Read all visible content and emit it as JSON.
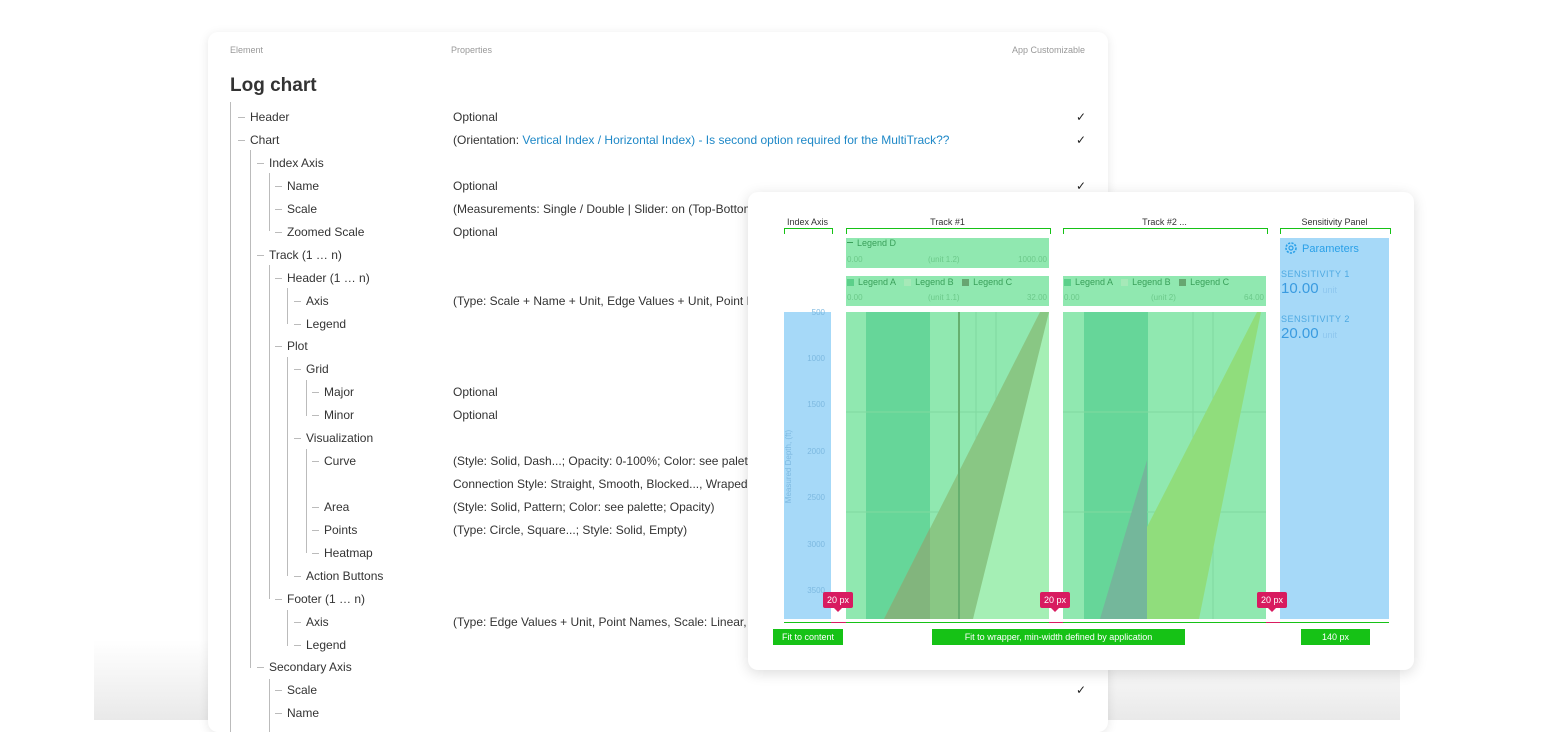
{
  "spec": {
    "col_element": "Element",
    "col_properties": "Properties",
    "col_custom": "App Customizable",
    "title": "Log chart",
    "rows": [
      {
        "label": "Header",
        "prop": "Optional",
        "check": "✓"
      },
      {
        "label": "Chart",
        "prop": "(Orientation: ",
        "prop_link": "Vertical Index / Horizontal Index) - Is second option required for the MultiTrack??",
        "check": "✓"
      },
      {
        "label": "Index Axis",
        "prop": "",
        "check": ""
      },
      {
        "label": "Name",
        "prop": "Optional",
        "check": "✓"
      },
      {
        "label": "Scale",
        "prop": "(Measurements: Single / Double | Slider: on (Top-Bottom",
        "check": ""
      },
      {
        "label": "Zoomed Scale",
        "prop": "Optional",
        "check": ""
      },
      {
        "label": "Track (1 … n)",
        "prop": "",
        "check": ""
      },
      {
        "label": "Header (1 … n)",
        "prop": "",
        "check": ""
      },
      {
        "label": "Axis",
        "prop": "(Type: Scale + Name + Unit, Edge Values + Unit, Point Na",
        "check": ""
      },
      {
        "label": "Legend",
        "prop": "",
        "check": ""
      },
      {
        "label": "Plot",
        "prop": "",
        "check": ""
      },
      {
        "label": "Grid",
        "prop": "",
        "check": ""
      },
      {
        "label": "Major",
        "prop": "Optional",
        "check": ""
      },
      {
        "label": "Minor",
        "prop": "Optional",
        "check": ""
      },
      {
        "label": "Visualization",
        "prop": "",
        "check": ""
      },
      {
        "label": "Curve",
        "prop": "(Style: Solid, Dash...; Opacity: 0-100%; Color: see palette,",
        "check": ""
      },
      {
        "label": "",
        "prop": "Connection Style: Straight, Smooth, Blocked..., Wraped: C",
        "check": ""
      },
      {
        "label": "Area",
        "prop": "(Style: Solid, Pattern; Color: see palette; Opacity)",
        "check": ""
      },
      {
        "label": "Points",
        "prop": "(Type: Circle, Square...; Style: Solid, Empty)",
        "check": ""
      },
      {
        "label": "Heatmap",
        "prop": "",
        "check": ""
      },
      {
        "label": "Action Buttons",
        "prop": "",
        "check": ""
      },
      {
        "label": "Footer (1 … n)",
        "prop": "",
        "check": ""
      },
      {
        "label": "Axis",
        "prop": "(Type: Edge Values + Unit, Point Names, Scale: Linear, Lo",
        "check": ""
      },
      {
        "label": "Legend",
        "prop": "",
        "check": ""
      },
      {
        "label": "Secondary Axis",
        "prop": "",
        "check": ""
      },
      {
        "label": "Scale",
        "prop": "",
        "check": "✓"
      },
      {
        "label": "Name",
        "prop": "",
        "check": ""
      }
    ]
  },
  "chart": {
    "index_axis_title": "Index Axis",
    "track1_title": "Track #1",
    "track2_title": "Track #2 ...",
    "sensitivity_title": "Sensitivity Panel",
    "legend_d": "Legend D",
    "legend_a": "Legend A",
    "legend_b": "Legend B",
    "legend_c": "Legend C",
    "track1_top": {
      "min": "0.00",
      "unit": "(unit 1.2)",
      "max": "1000.00"
    },
    "track1_axis": {
      "min": "0.00",
      "unit": "(unit 1.1)",
      "max": "32.00"
    },
    "track2_axis": {
      "min": "0.00",
      "unit": "(unit 2)",
      "max": "64.00"
    },
    "depth_label": "Measured Depth, (ft)",
    "depth_ticks": [
      "500",
      "1000",
      "1500",
      "2000",
      "2500",
      "3000",
      "3500"
    ],
    "parameters_label": "Parameters",
    "sens1_label": "SENSITIVITY 1",
    "sens1_value": "10.00",
    "sens1_unit": "unit",
    "sens2_label": "SENSITIVITY 2",
    "sens2_value": "20.00",
    "sens2_unit": "unit",
    "gap_label": "20 px",
    "fit_content": "Fit to content",
    "fit_wrapper": "Fit to wrapper, min-width defined by application",
    "panel_width": "140 px"
  }
}
